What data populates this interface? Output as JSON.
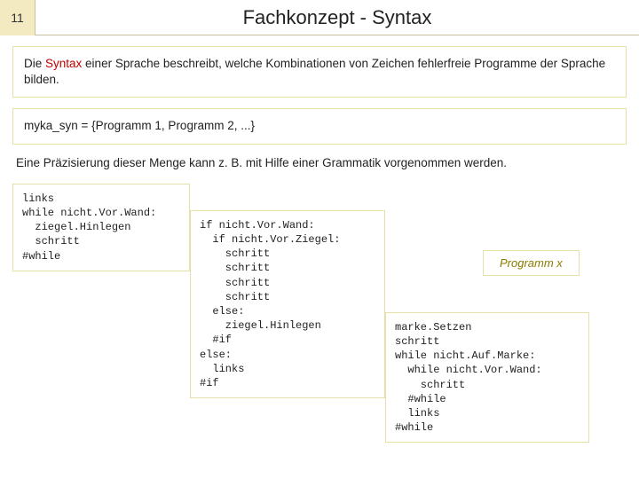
{
  "header": {
    "slide_number": "11",
    "title": "Fachkonzept - Syntax"
  },
  "box1": {
    "pre": "Die ",
    "syntax_word": "Syntax",
    "post": " einer Sprache beschreibt, welche Kombinationen von Zeichen fehlerfreie Programme der Sprache bilden."
  },
  "box2": {
    "text": "myka_syn = {Programm 1, Programm 2, ...}"
  },
  "free_text": "Eine Präzisierung dieser Menge kann z. B. mit Hilfe einer Grammatik vorgenommen werden.",
  "code1": "links\nwhile nicht.Vor.Wand:\n  ziegel.Hinlegen\n  schritt\n#while",
  "code2": "if nicht.Vor.Wand:\n  if nicht.Vor.Ziegel:\n    schritt\n    schritt\n    schritt\n    schritt\n  else:\n    ziegel.Hinlegen\n  #if\nelse:\n  links\n#if",
  "code3": "marke.Setzen\nschritt\nwhile nicht.Auf.Marke:\n  while nicht.Vor.Wand:\n    schritt\n  #while\n  links\n#while",
  "prog_label": "Programm x"
}
